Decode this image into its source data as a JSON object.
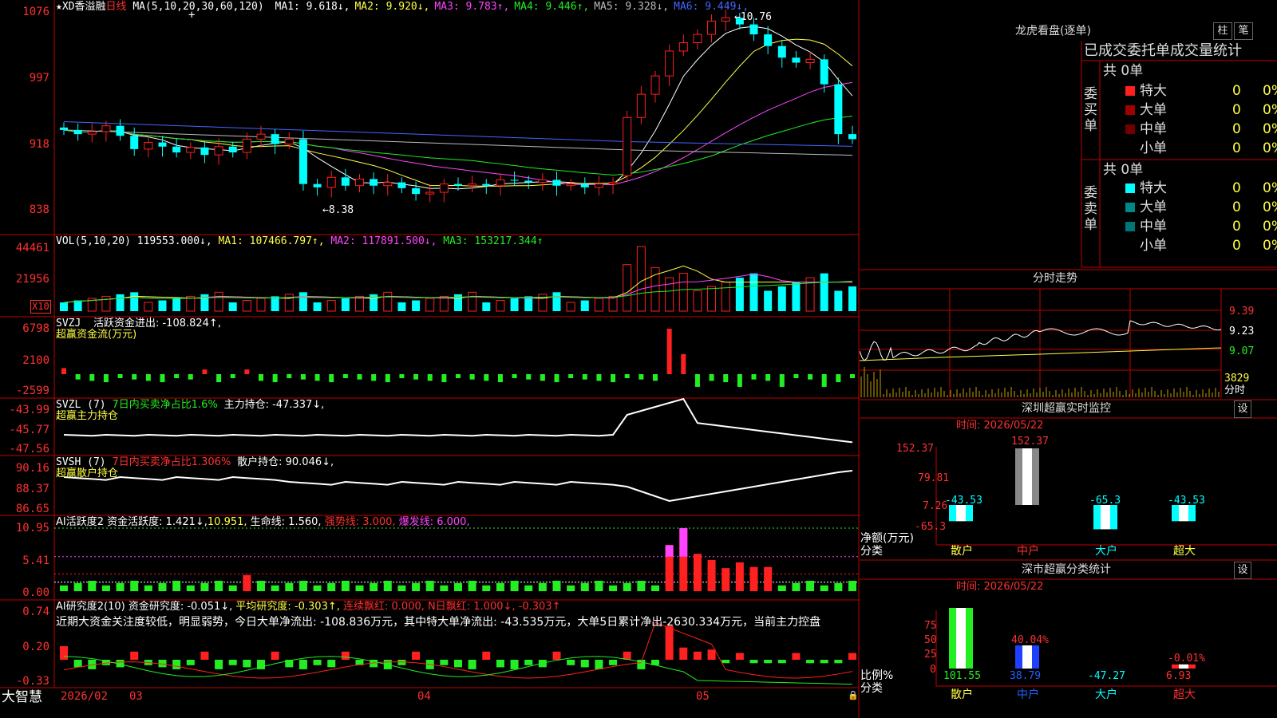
{
  "main": {
    "title_star": "★XD香溢融",
    "period": "日线",
    "ma_params": "MA(5,10,20,30,60,120)",
    "ma_items": [
      {
        "label": "MA1:",
        "value": "9.618↓",
        "color": "#ffffff"
      },
      {
        "label": "MA2:",
        "value": "9.920↓",
        "color": "#ffff44"
      },
      {
        "label": "MA3:",
        "value": "9.783↑",
        "color": "#ff44ff"
      },
      {
        "label": "MA4:",
        "value": "9.446↑",
        "color": "#22ee22"
      },
      {
        "label": "MA5:",
        "value": "9.328↓",
        "color": "#bbbbbb"
      },
      {
        "label": "MA6:",
        "value": "9.449↓",
        "color": "#4466ff"
      }
    ],
    "y_ticks": [
      "1076",
      "997",
      "918",
      "838"
    ],
    "high_label": "←10.76",
    "low_label": "←8.38"
  },
  "vol": {
    "label": "VOL(5,10,20)",
    "value": "119553.000↓,",
    "ma1": "MA1: 107466.797↑,",
    "ma2": "MA2: 117891.500↓,",
    "ma3": "MA3: 153217.344↑",
    "y_ticks": [
      "44461",
      "21956"
    ],
    "unit": "X10"
  },
  "svzj": {
    "name": "SVZJ",
    "desc": "活跃资金进出: -108.824↑,",
    "caption": "超赢资金流(万元)",
    "y_ticks": [
      "6798",
      "2100",
      "-2599"
    ]
  },
  "svzl": {
    "name": "SVZL (7)",
    "desc1": "7日内买卖净占比1.6%",
    "desc2": "主力持仓: -47.337↓,",
    "caption": "超赢主力持仓",
    "y_ticks": [
      "-43.99",
      "-45.77",
      "-47.56"
    ]
  },
  "svsh": {
    "name": "SVSH (7)",
    "desc1": "7日内买卖净占比1.306%",
    "desc2": "散户持仓: 90.046↓,",
    "caption": "超赢散户持仓",
    "y_ticks": [
      "90.16",
      "88.37",
      "86.65"
    ]
  },
  "ai1": {
    "name": "AI活跃度2",
    "d1": "资金活跃度: 1.421↓,",
    "d2": "10.951,",
    "d3": "生命线: 1.560,",
    "d4": "强势线: 3.000,",
    "d5": "爆发线: 6.000,",
    "y_ticks": [
      "10.95",
      "5.41",
      "0.00"
    ]
  },
  "ai2": {
    "name": "AI研究度2(10)",
    "d1": "资金研究度: -0.051↓,",
    "d2": "平均研究度: -0.303↑,",
    "d3": "连续飘红: 0.000,",
    "d4": "N日飘红: 1.000↓,",
    "d5": "-0.303↑",
    "summary": "近期大资金关注度较低，明显弱势，今日大单净流出: -108.836万元，其中特大单净流出: -43.535万元，大单5日累计净出-2630.334万元，当前主力控盘",
    "y_ticks": [
      "0.74",
      "0.20",
      "-0.33"
    ]
  },
  "xaxis": {
    "brand": "大智慧",
    "labels": [
      "2026/02",
      "03",
      "04",
      "05"
    ]
  },
  "right": {
    "lhb_title": "龙虎看盘(逐单)",
    "btn1": "柱",
    "btn2": "笔",
    "order_title": "已成交委托单成交量统计",
    "buy_side": "委买单",
    "sell_side": "委卖单",
    "buy_total": "共 0单",
    "sell_total": "共 0单",
    "buy_rows": [
      {
        "name": "特大",
        "count": "0",
        "pct": "0%",
        "color": "#ff2020"
      },
      {
        "name": "大单",
        "count": "0",
        "pct": "0%",
        "color": "#a00000"
      },
      {
        "name": "中单",
        "count": "0",
        "pct": "0%",
        "color": "#700000"
      },
      {
        "name": "小单",
        "count": "0",
        "pct": "0%",
        "color": ""
      }
    ],
    "sell_rows": [
      {
        "name": "特大",
        "count": "0",
        "pct": "0%",
        "color": "#00ffff"
      },
      {
        "name": "大单",
        "count": "0",
        "pct": "0%",
        "color": "#008888"
      },
      {
        "name": "中单",
        "count": "0",
        "pct": "0%",
        "color": "#007777"
      },
      {
        "name": "小单",
        "count": "0",
        "pct": "0%",
        "color": ""
      }
    ],
    "fs_title": "分时走势",
    "fs_ticks": [
      "9.39",
      "9.23",
      "9.07",
      "3829"
    ],
    "fs_label": "分时",
    "sz_title": "深圳超赢实时监控",
    "sz_btn": "设",
    "sz_time": "时间: 2026/05/22",
    "sz_ticks": [
      "152.37",
      "79.81",
      "7.26",
      "-65.3"
    ],
    "sz_ylabel1": "净额(万元)",
    "sz_ylabel2": "分类",
    "sz_cats": [
      "散户",
      "中户",
      "大户",
      "超大"
    ],
    "sz_vals": [
      "-43.53",
      "152.37",
      "-65.3",
      "-43.53"
    ],
    "cls_title": "深市超赢分类统计",
    "cls_btn": "设",
    "cls_time": "时间: 2026/05/22",
    "cls_ticks": [
      "75",
      "50",
      "25",
      "0"
    ],
    "cls_ylabel1": "比例%",
    "cls_ylabel2": "分类",
    "cls_bar_labels": [
      "",
      "40.04%",
      "",
      "-0.01%"
    ],
    "cls_vals": [
      "101.55",
      "38.79",
      "-47.27",
      "6.93"
    ],
    "cls_cats": [
      "散户",
      "中户",
      "大户",
      "超大"
    ]
  },
  "chart_data": {
    "type": "candlestick",
    "title": "XD香溢融 日线",
    "x_dates_shown": [
      "2026/02",
      "03",
      "04",
      "05"
    ],
    "ylim": [
      838,
      1076
    ],
    "close_approx": [
      935,
      930,
      933,
      940,
      928,
      912,
      920,
      915,
      908,
      914,
      905,
      915,
      908,
      924,
      930,
      918,
      924,
      870,
      866,
      878,
      868,
      876,
      868,
      872,
      865,
      858,
      860,
      870,
      868,
      870,
      868,
      875,
      874,
      872,
      875,
      868,
      870,
      866,
      870,
      872,
      950,
      978,
      1000,
      1030,
      1040,
      1050,
      1066,
      1070,
      1062,
      1050,
      1036,
      1022,
      1016,
      1020,
      990,
      930,
      924
    ],
    "volume_max": 44461,
    "annotations": [
      "10.76",
      "8.38"
    ]
  }
}
